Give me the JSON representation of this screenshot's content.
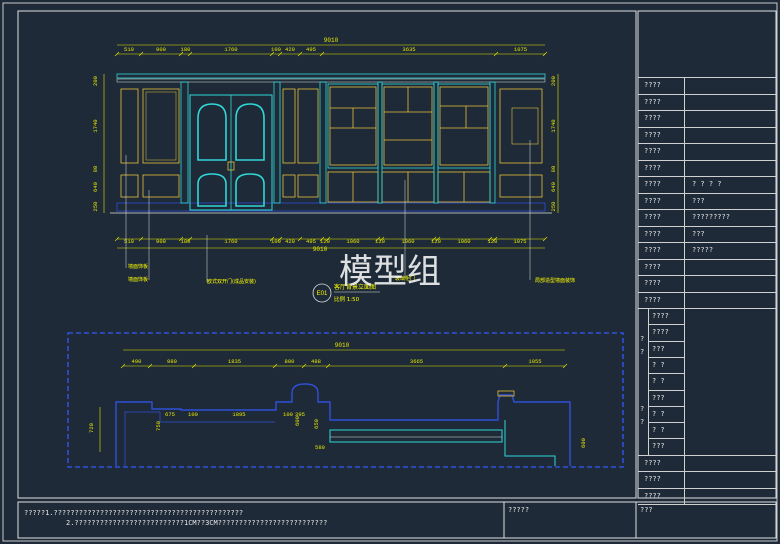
{
  "watermark": "模型组",
  "elevation": {
    "id_tag": "E01",
    "title": "客厅背景立面图",
    "scale": "比例 1:50",
    "total_top": "9010",
    "top_dims": [
      "510",
      "900",
      "180",
      "1760",
      "100",
      "420",
      "495",
      "3635",
      "1075"
    ],
    "bottom_dims": [
      "510",
      "900",
      "180",
      "1760",
      "100",
      "420",
      "495",
      "120",
      "1060",
      "120",
      "1060",
      "120",
      "1060",
      "120",
      "1075"
    ],
    "bottom_total": "9010",
    "left_dims": [
      "200",
      "1740",
      "80",
      "640",
      "250"
    ],
    "right_dims": [
      "200",
      "1740",
      "80",
      "640",
      "250"
    ],
    "labels": [
      "墙面饰板",
      "墙面饰板",
      "欧式双开门(成品安装)",
      "玻璃柜门",
      "局部造型墙面装饰"
    ]
  },
  "plan": {
    "total": "9010",
    "top_dims": [
      "490",
      "980",
      "1835",
      "800",
      "488",
      "3665",
      "1055"
    ],
    "inner_dims": [
      "675",
      "100",
      "1895",
      "100",
      "395"
    ],
    "side_dims": [
      "720",
      "750",
      "600",
      "650",
      "580",
      "600"
    ]
  },
  "title_block": {
    "rows": [
      {
        "label": "????",
        "value": ""
      },
      {
        "label": "????",
        "value": ""
      },
      {
        "label": "????",
        "value": ""
      },
      {
        "label": "????",
        "value": ""
      },
      {
        "label": "????",
        "value": ""
      },
      {
        "label": "????",
        "value": ""
      },
      {
        "label": "????",
        "value": "?    ?        ?    ?"
      },
      {
        "label": "????",
        "value": "???"
      },
      {
        "label": "????",
        "value": "?????????"
      },
      {
        "label": "????",
        "value": "???"
      },
      {
        "label": "????",
        "value": "?????"
      },
      {
        "label": "????",
        "value": ""
      },
      {
        "label": "????",
        "value": ""
      },
      {
        "label": "????",
        "value": ""
      }
    ],
    "sub_rows": [
      "????",
      "????",
      "???",
      "?   ?",
      "?   ?",
      "???",
      "?   ?",
      "?   ?",
      "???"
    ],
    "side_marks": [
      "?",
      "?",
      "?",
      "?"
    ],
    "bottom_rows": [
      "????",
      "????",
      "????"
    ]
  },
  "notes": {
    "line1": "?????1.?????????????????????????????????????????????",
    "line2": "2.??????????????????????????1CM??3CM??????????????????????????",
    "mid": "?????",
    "right": "???"
  },
  "colors": {
    "background": "#1e2a37",
    "frame": "#e0e0e0",
    "dimension": "#e8e800",
    "panel_yellow": "#e8c23a",
    "door_cyan": "#30d8d8",
    "blue": "#2f4fd8",
    "label_yellow": "#ffff00"
  }
}
